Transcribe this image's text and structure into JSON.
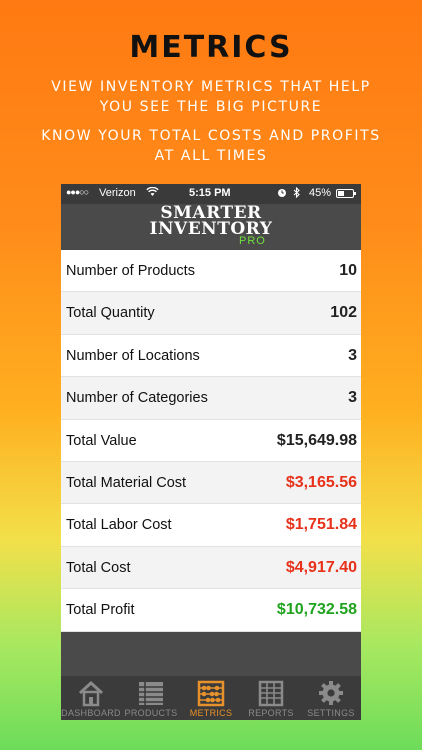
{
  "promo": {
    "title": "METRICS",
    "lines": [
      "VIEW INVENTORY METRICS THAT HELP",
      "YOU SEE THE BIG PICTURE",
      "KNOW YOUR TOTAL COSTS AND PROFITS",
      "AT ALL TIMES"
    ]
  },
  "status_bar": {
    "signal": "●●●○○",
    "carrier": "Verizon",
    "wifi_icon": "wifi-icon",
    "time": "5:15 PM",
    "alarm_icon": "alarm-clock-icon",
    "bluetooth_icon": "bluetooth-icon",
    "battery": "45%",
    "battery_level": 0.45
  },
  "app": {
    "logo_line1": "SMARTER",
    "logo_line2": "INVENTORY",
    "logo_pro": "PRO"
  },
  "metrics": [
    {
      "label": "Number of Products",
      "value": "10"
    },
    {
      "label": "Total Quantity",
      "value": "102"
    },
    {
      "label": "Number of Locations",
      "value": "3"
    },
    {
      "label": "Number of Categories",
      "value": "3"
    },
    {
      "label": "Total Value",
      "value": "$15,649.98"
    },
    {
      "label": "Total Material Cost",
      "value": "$3,165.56"
    },
    {
      "label": "Total Labor Cost",
      "value": "$1,751.84"
    },
    {
      "label": "Total Cost",
      "value": "$4,917.40"
    },
    {
      "label": "Total Profit",
      "value": "$10,732.58"
    }
  ],
  "tabs": [
    {
      "label": "DASHBOARD",
      "icon": "house-icon"
    },
    {
      "label": "PRODUCTS",
      "icon": "product-list-icon"
    },
    {
      "label": "METRICS",
      "icon": "abacus-icon",
      "active": true
    },
    {
      "label": "REPORTS",
      "icon": "report-sheet-icon"
    },
    {
      "label": "SETTINGS",
      "icon": "gear-icon"
    }
  ],
  "colors": {
    "cost": "#e8311a",
    "profit": "#1fa31f",
    "active_tab": "#e6912b",
    "pro_green": "#6ee13c"
  }
}
